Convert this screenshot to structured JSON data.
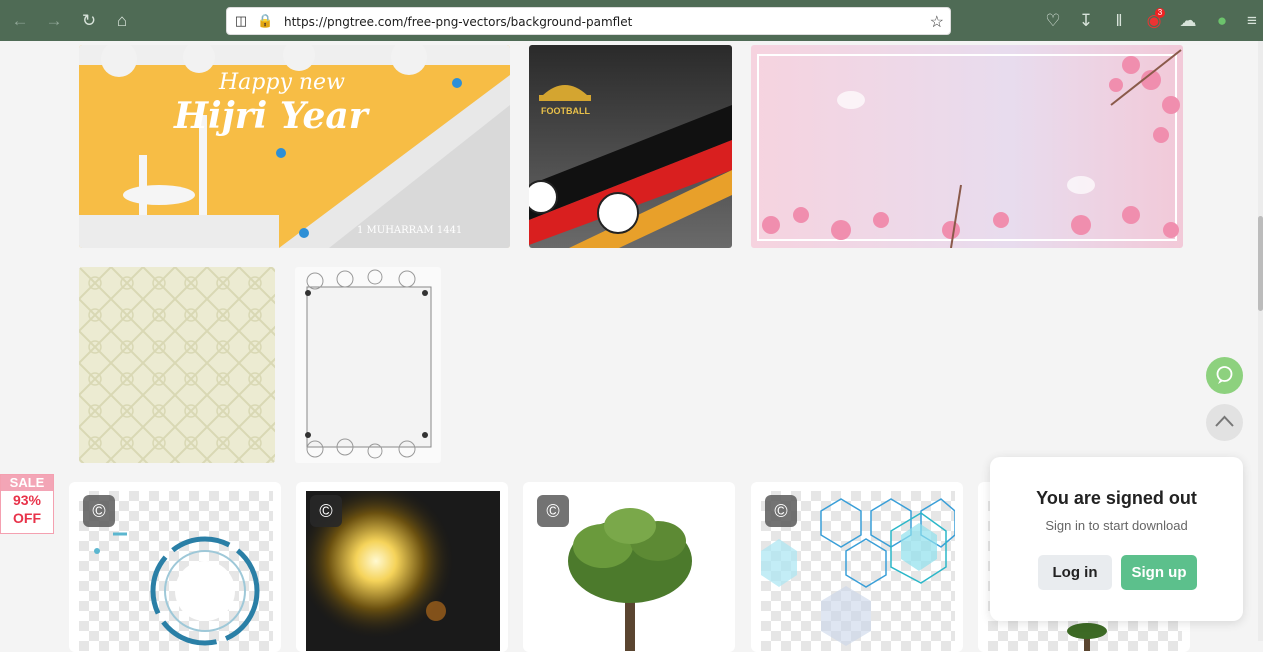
{
  "browser": {
    "url": "https://pngtree.com/free-png-vectors/background-pamflet",
    "notification_count": "3",
    "icons": [
      "back-icon",
      "forward-icon",
      "reload-icon",
      "home-icon",
      "shield-icon",
      "lock-icon",
      "bookmark-star-icon",
      "pocket-icon",
      "download-icon",
      "library-icon",
      "extension-icon",
      "cloud-icon",
      "globe-icon",
      "menu-icon"
    ]
  },
  "gallery": {
    "row1": [
      {
        "name": "hijri-new-year-banner",
        "text_line1": "Happy new",
        "text_line2": "Hijri Year",
        "text_line3": "1 MUHARRAM 1441"
      },
      {
        "name": "germany-football-banner",
        "label": "FOOTBALL"
      },
      {
        "name": "cherry-blossom-frame"
      }
    ],
    "row2": [
      {
        "name": "pale-pattern-background"
      },
      {
        "name": "floral-frame-paper"
      }
    ]
  },
  "cards": [
    {
      "name": "tech-circle-hud",
      "copyright": "©"
    },
    {
      "name": "golden-sun-flare",
      "copyright": "©"
    },
    {
      "name": "green-tree",
      "copyright": "©"
    },
    {
      "name": "hexagon-pattern",
      "copyright": "©"
    },
    {
      "name": "small-tree"
    }
  ],
  "sale": {
    "label": "SALE",
    "percent": "93%",
    "off": "OFF"
  },
  "signin_panel": {
    "title": "You are signed out",
    "subtitle": "Sign in to start download",
    "login_label": "Log in",
    "signup_label": "Sign up"
  },
  "colors": {
    "toolbar": "#4f6b55",
    "signup": "#5cc08c",
    "sale_red": "#e8334a",
    "chat_green": "#8dd17e"
  }
}
